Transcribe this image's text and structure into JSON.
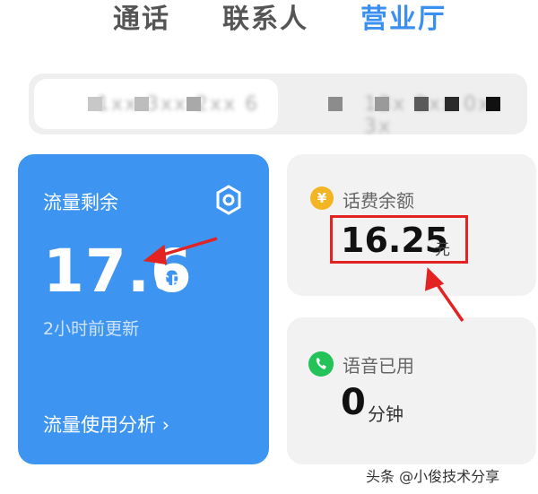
{
  "tabs": [
    {
      "label": "通话",
      "active": false
    },
    {
      "label": "联系人",
      "active": false
    },
    {
      "label": "营业厅",
      "active": true
    }
  ],
  "sim_cards": [
    {
      "number": "1xx 3xx 2xx 6",
      "selected": true
    },
    {
      "number": "13x 0xx 0x 3x",
      "selected": false
    }
  ],
  "data_card": {
    "title": "流量剩余",
    "value": "17.6",
    "unit": "GB",
    "updated": "2小时前更新",
    "analysis_label": "流量使用分析 ›"
  },
  "fee_card": {
    "icon_glyph": "¥",
    "title": "话费余额",
    "value": "16.25",
    "unit": "元"
  },
  "voice_card": {
    "title": "语音已用",
    "value": "0",
    "unit": "分钟"
  },
  "watermark": "头条 @小俊技术分享",
  "colors": {
    "accent": "#3a8ff0",
    "data_card_bg": "#3e95f1",
    "annotation_red": "#e32222",
    "coin": "#f4b524",
    "phone": "#24c35a"
  },
  "icons": [
    "gear-icon",
    "yen-coin-icon",
    "phone-icon",
    "chevron-right-icon"
  ]
}
